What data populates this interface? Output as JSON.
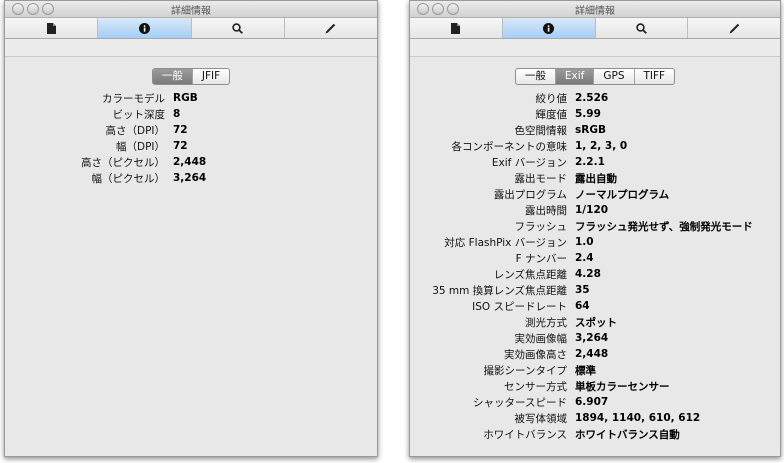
{
  "left_window": {
    "title": "詳細情報",
    "tabs": [
      "一般",
      "JFIF"
    ],
    "selected_tab": 0,
    "rows": [
      {
        "label": "カラーモデル",
        "value": "RGB"
      },
      {
        "label": "ビット深度",
        "value": "8"
      },
      {
        "label": "高さ（DPI）",
        "value": "72"
      },
      {
        "label": "幅（DPI）",
        "value": "72"
      },
      {
        "label": "高さ（ピクセル）",
        "value": "2,448"
      },
      {
        "label": "幅（ピクセル）",
        "value": "3,264"
      }
    ]
  },
  "right_window": {
    "title": "詳細情報",
    "tabs": [
      "一般",
      "Exif",
      "GPS",
      "TIFF"
    ],
    "selected_tab": 1,
    "rows": [
      {
        "label": "絞り値",
        "value": "2.526"
      },
      {
        "label": "輝度値",
        "value": "5.99"
      },
      {
        "label": "色空間情報",
        "value": "sRGB"
      },
      {
        "label": "各コンポーネントの意味",
        "value": "1, 2, 3, 0"
      },
      {
        "label": "Exif バージョン",
        "value": "2.2.1"
      },
      {
        "label": "露出モード",
        "value": "露出自動"
      },
      {
        "label": "露出プログラム",
        "value": "ノーマルプログラム"
      },
      {
        "label": "露出時間",
        "value": "1/120"
      },
      {
        "label": "フラッシュ",
        "value": "フラッシュ発光せず、強制発光モード"
      },
      {
        "label": "対応 FlashPix バージョン",
        "value": "1.0"
      },
      {
        "label": "F ナンバー",
        "value": "2.4"
      },
      {
        "label": "レンズ焦点距離",
        "value": "4.28"
      },
      {
        "label": "35 mm 換算レンズ焦点距離",
        "value": "35"
      },
      {
        "label": "ISO スピードレート",
        "value": "64"
      },
      {
        "label": "測光方式",
        "value": "スポット"
      },
      {
        "label": "実効画像幅",
        "value": "3,264"
      },
      {
        "label": "実効画像高さ",
        "value": "2,448"
      },
      {
        "label": "撮影シーンタイプ",
        "value": "標準"
      },
      {
        "label": "センサー方式",
        "value": "単板カラーセンサー"
      },
      {
        "label": "シャッタースピード",
        "value": "6.907"
      },
      {
        "label": "被写体領域",
        "value": "1894, 1140, 610, 612"
      },
      {
        "label": "ホワイトバランス",
        "value": "ホワイトバランス自動"
      }
    ]
  },
  "toolbar_icons": [
    "document-icon",
    "info-icon",
    "search-icon",
    "pen-icon"
  ],
  "colors": {
    "active_tab": "#a7cdf3",
    "selected_segment": "#7a7a7a"
  }
}
